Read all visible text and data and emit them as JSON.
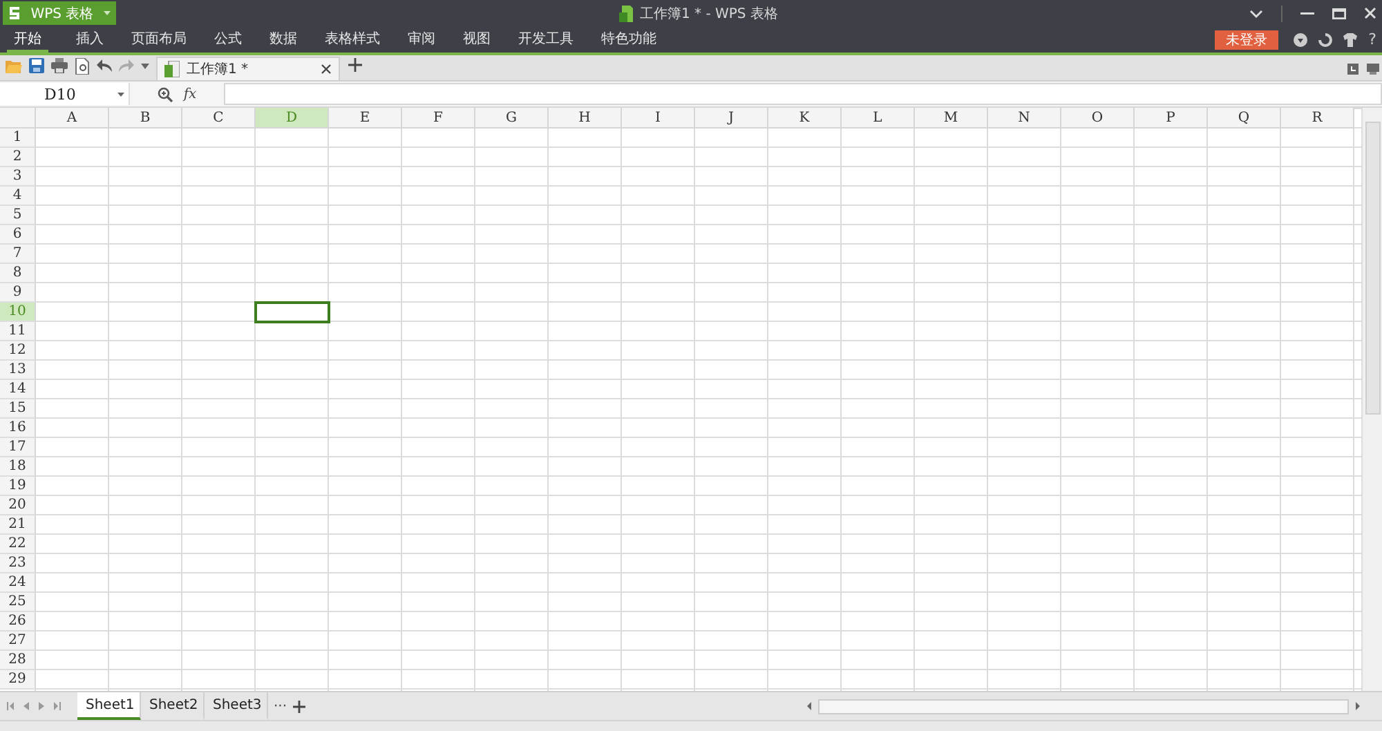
{
  "app_button": {
    "label": "WPS 表格"
  },
  "window": {
    "title": "工作簿1 * - WPS 表格"
  },
  "menu": [
    {
      "label": "开始",
      "selected": true
    },
    {
      "label": "插入",
      "selected": false
    },
    {
      "label": "页面布局",
      "selected": false
    },
    {
      "label": "公式",
      "selected": false
    },
    {
      "label": "数据",
      "selected": false
    },
    {
      "label": "表格样式",
      "selected": false
    },
    {
      "label": "审阅",
      "selected": false
    },
    {
      "label": "视图",
      "selected": false
    },
    {
      "label": "开发工具",
      "selected": false
    },
    {
      "label": "特色功能",
      "selected": false
    }
  ],
  "login_button": {
    "label": "未登录"
  },
  "help": {
    "label": "?"
  },
  "doc_tabs": [
    {
      "label": "工作簿1 *",
      "selected": true
    }
  ],
  "name_box": {
    "value": "D10"
  },
  "formula_bar": {
    "fx_label": "fx"
  },
  "columns": [
    {
      "label": "A",
      "selected": false
    },
    {
      "label": "B",
      "selected": false
    },
    {
      "label": "C",
      "selected": false
    },
    {
      "label": "D",
      "selected": true
    },
    {
      "label": "E",
      "selected": false
    },
    {
      "label": "F",
      "selected": false
    },
    {
      "label": "G",
      "selected": false
    },
    {
      "label": "H",
      "selected": false
    },
    {
      "label": "I",
      "selected": false
    },
    {
      "label": "J",
      "selected": false
    },
    {
      "label": "K",
      "selected": false
    },
    {
      "label": "L",
      "selected": false
    },
    {
      "label": "M",
      "selected": false
    },
    {
      "label": "N",
      "selected": false
    },
    {
      "label": "O",
      "selected": false
    },
    {
      "label": "P",
      "selected": false
    },
    {
      "label": "Q",
      "selected": false
    },
    {
      "label": "R",
      "selected": false
    }
  ],
  "rows": [
    {
      "label": "1",
      "selected": false
    },
    {
      "label": "2",
      "selected": false
    },
    {
      "label": "3",
      "selected": false
    },
    {
      "label": "4",
      "selected": false
    },
    {
      "label": "5",
      "selected": false
    },
    {
      "label": "6",
      "selected": false
    },
    {
      "label": "7",
      "selected": false
    },
    {
      "label": "8",
      "selected": false
    },
    {
      "label": "9",
      "selected": false
    },
    {
      "label": "10",
      "selected": true
    },
    {
      "label": "11",
      "selected": false
    },
    {
      "label": "12",
      "selected": false
    },
    {
      "label": "13",
      "selected": false
    },
    {
      "label": "14",
      "selected": false
    },
    {
      "label": "15",
      "selected": false
    },
    {
      "label": "16",
      "selected": false
    },
    {
      "label": "17",
      "selected": false
    },
    {
      "label": "18",
      "selected": false
    },
    {
      "label": "19",
      "selected": false
    },
    {
      "label": "20",
      "selected": false
    },
    {
      "label": "21",
      "selected": false
    },
    {
      "label": "22",
      "selected": false
    },
    {
      "label": "23",
      "selected": false
    },
    {
      "label": "24",
      "selected": false
    },
    {
      "label": "25",
      "selected": false
    },
    {
      "label": "26",
      "selected": false
    },
    {
      "label": "27",
      "selected": false
    },
    {
      "label": "28",
      "selected": false
    },
    {
      "label": "29",
      "selected": false
    }
  ],
  "sheet_tabs": [
    {
      "label": "Sheet1",
      "selected": true
    },
    {
      "label": "Sheet2",
      "selected": false
    },
    {
      "label": "Sheet3",
      "selected": false
    }
  ],
  "sheet_more": {
    "label": "···"
  }
}
